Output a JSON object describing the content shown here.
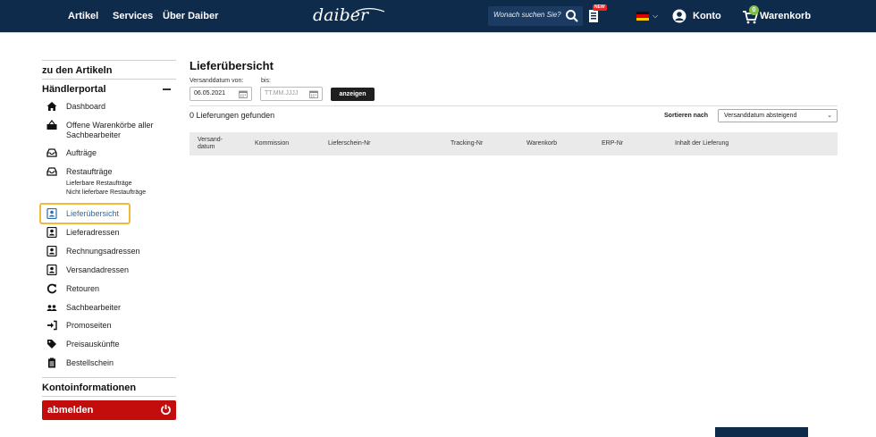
{
  "header": {
    "nav": [
      "Artikel",
      "Services",
      "Über Daiber"
    ],
    "logo_text": "daiber",
    "search_placeholder": "Wonach suchen Sie?",
    "new_badge": "NEW",
    "account_label": "Konto",
    "cart_label": "Warenkorb",
    "cart_count": "0",
    "bg_color": "#0f2b4c"
  },
  "sidebar": {
    "back_link": "zu den Artikeln",
    "section_title": "Händlerportal",
    "items": [
      {
        "label": "Dashboard",
        "icon": "home-icon"
      },
      {
        "label": "Offene Warenkörbe aller Sachbearbeiter",
        "icon": "basket-icon"
      },
      {
        "label": "Aufträge",
        "icon": "tray-icon"
      },
      {
        "label": "Restaufträge",
        "icon": "tray-icon"
      },
      {
        "label": "Lieferübersicht",
        "icon": "contact-card-icon",
        "active": true
      },
      {
        "label": "Lieferadressen",
        "icon": "contact-card-icon"
      },
      {
        "label": "Rechnungsadressen",
        "icon": "contact-card-icon"
      },
      {
        "label": "Versandadressen",
        "icon": "contact-card-icon"
      },
      {
        "label": "Retouren",
        "icon": "refresh-icon"
      },
      {
        "label": "Sachbearbeiter",
        "icon": "users-icon"
      },
      {
        "label": "Promoseiten",
        "icon": "sign-in-icon"
      },
      {
        "label": "Preisauskünfte",
        "icon": "tag-icon"
      },
      {
        "label": "Bestellschein",
        "icon": "clipboard-icon"
      }
    ],
    "sub_items": [
      "Lieferbare Restaufträge",
      "Nicht lieferbare Restaufträge"
    ],
    "account_section": "Kontoinformationen",
    "logout_label": "abmelden",
    "logout_color": "#c30d0d"
  },
  "main": {
    "title": "Lieferübersicht",
    "date_from_label": "Versanddatum von:",
    "date_to_label": "bis:",
    "date_from_value": "06.05.2021",
    "date_to_placeholder": "TT.MM.JJJJ",
    "show_button": "anzeigen",
    "results_text": "0 Lieferungen gefunden",
    "sort_label": "Sortieren nach",
    "sort_value": "Versanddatum absteigend",
    "columns": [
      "Versand-\ndatum",
      "Kommission",
      "Lieferschein-Nr",
      "Tracking-Nr",
      "Warenkorb",
      "ERP-Nr",
      "Inhalt der Lieferung"
    ],
    "highlight_color": "#f0b93a"
  }
}
